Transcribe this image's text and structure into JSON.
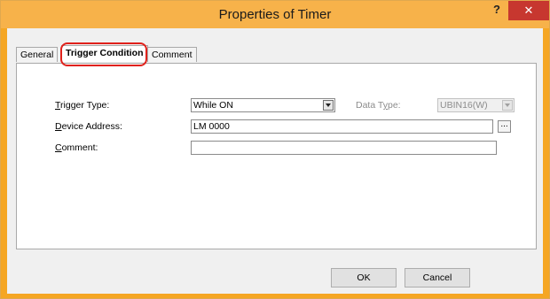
{
  "window": {
    "title": "Properties of Timer",
    "help_label": "?",
    "close_label": "✕"
  },
  "tabs": [
    {
      "label": "General"
    },
    {
      "label": "Trigger Condition"
    },
    {
      "label": "Comment"
    }
  ],
  "form": {
    "trigger_type": {
      "mnemonic": "T",
      "label_rest": "rigger Type:",
      "value": "While ON"
    },
    "data_type": {
      "label_pre": "Data T",
      "mnemonic": "y",
      "label_post": "pe:",
      "value": "UBIN16(W)"
    },
    "device_address": {
      "mnemonic": "D",
      "label_rest": "evice Address:",
      "value": "LM 0000",
      "browse_label": "..."
    },
    "comment": {
      "mnemonic": "C",
      "label_rest": "omment:",
      "value": ""
    }
  },
  "buttons": {
    "ok": "OK",
    "cancel": "Cancel"
  },
  "colors": {
    "titlebar": "#f7b24a",
    "close": "#c7372f",
    "highlight": "#e0211b"
  }
}
